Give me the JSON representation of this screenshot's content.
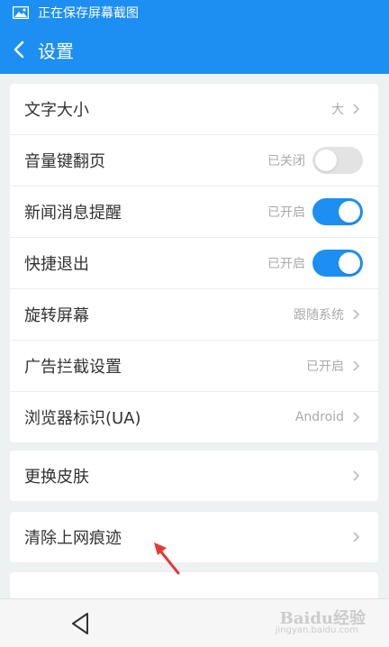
{
  "statusbar": {
    "text": "正在保存屏幕截图",
    "icon": "image-icon"
  },
  "header": {
    "title": "设置",
    "back_icon": "chevron-left-icon"
  },
  "group1": [
    {
      "label": "文字大小",
      "value": "大"
    },
    {
      "label": "音量键翻页",
      "value": "已关闭",
      "toggle": "off"
    },
    {
      "label": "新闻消息提醒",
      "value": "已开启",
      "toggle": "on"
    },
    {
      "label": "快捷退出",
      "value": "已开启",
      "toggle": "on"
    },
    {
      "label": "旋转屏幕",
      "value": "跟随系统"
    },
    {
      "label": "广告拦截设置",
      "value": "已开启"
    },
    {
      "label": "浏览器标识(UA)",
      "value": "Android"
    }
  ],
  "group2": [
    {
      "label": "更换皮肤"
    }
  ],
  "group3": [
    {
      "label": "清除上网痕迹"
    }
  ],
  "watermark": {
    "text": "Baidu经验",
    "sub": "jingyan.baidu.com"
  },
  "colors": {
    "accent": "#1d8ff2",
    "arrow": "#e53935"
  }
}
